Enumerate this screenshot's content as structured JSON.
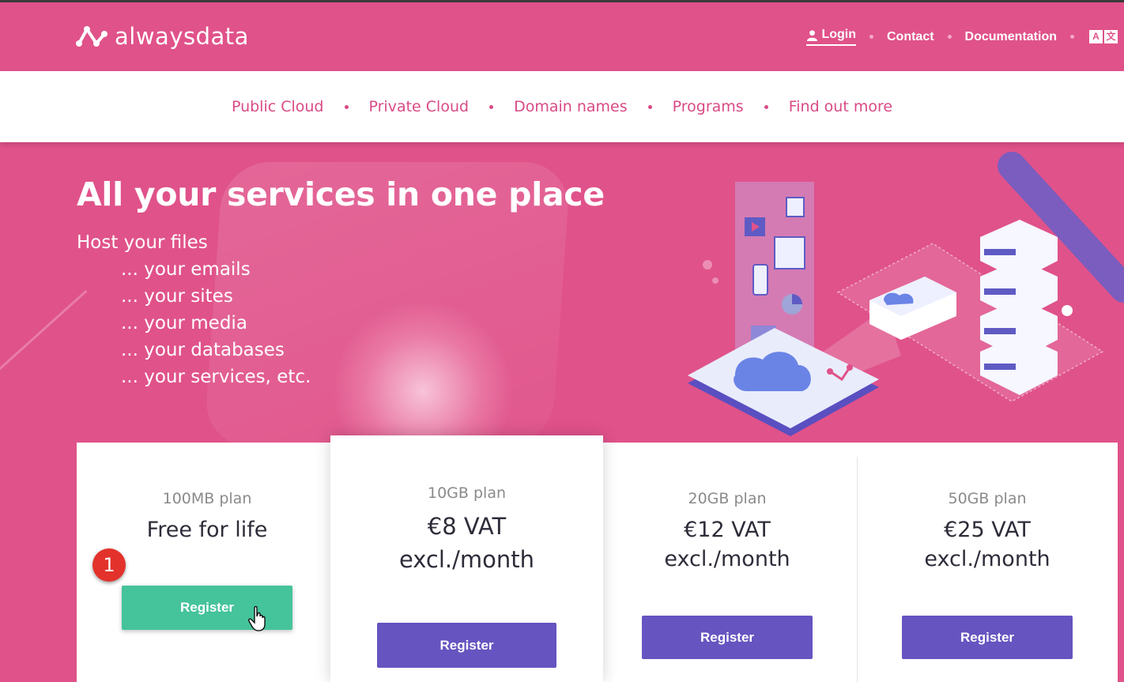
{
  "header": {
    "brand": "alwaysdata",
    "nav": {
      "login": "Login",
      "contact": "Contact",
      "documentation": "Documentation",
      "lang_a": "A",
      "lang_b": "文"
    }
  },
  "subnav": {
    "items": [
      "Public Cloud",
      "Private Cloud",
      "Domain names",
      "Programs",
      "Find out more"
    ]
  },
  "hero": {
    "title": "All your services in one place",
    "lines": [
      "Host your files",
      "... your emails",
      "... your sites",
      "... your media",
      "... your databases",
      "... your services, etc."
    ]
  },
  "plans": [
    {
      "name": "100MB plan",
      "price_line1": "Free for life",
      "price_line2": "",
      "button": "Register"
    },
    {
      "name": "10GB plan",
      "price_line1": "€8 VAT",
      "price_line2": "excl./month",
      "button": "Register"
    },
    {
      "name": "20GB plan",
      "price_line1": "€12 VAT",
      "price_line2": "excl./month",
      "button": "Register"
    },
    {
      "name": "50GB plan",
      "price_line1": "€25 VAT",
      "price_line2": "excl./month",
      "button": "Register"
    }
  ],
  "annotation": {
    "step": "1"
  },
  "colors": {
    "brand_pink": "#e0528a",
    "button_purple": "#6654c0",
    "button_green": "#45c39a",
    "badge_red": "#e2322b"
  }
}
